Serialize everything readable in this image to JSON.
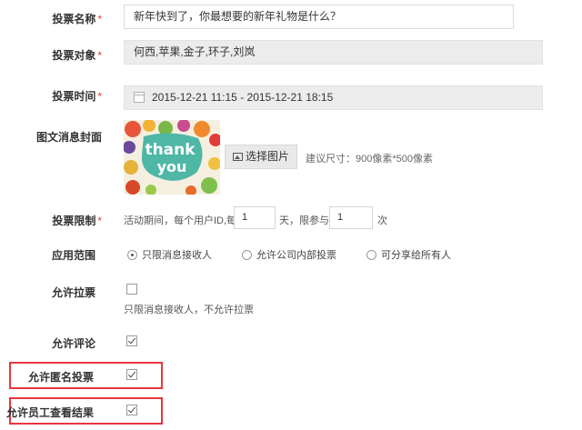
{
  "vote_name": {
    "label": "投票名称",
    "required": "*",
    "value": "新年快到了，你最想要的新年礼物是什么？"
  },
  "vote_target": {
    "label": "投票对象",
    "required": "*",
    "value": "何西,苹果,金子,环子,刘岚"
  },
  "vote_time": {
    "label": "投票时间",
    "required": "*",
    "value": "2015-12-21 11:15 - 2015-12-21 18:15"
  },
  "cover": {
    "label": "图文消息封面",
    "image_text_top": "thank",
    "image_text_bottom": "you",
    "button_label": "选择图片",
    "hint": "建议尺寸：900像素*500像素"
  },
  "vote_limit": {
    "label": "投票限制",
    "required": "*",
    "prefix": "活动期间，每个用户ID,每",
    "days_value": "1",
    "middle": "天，限参与",
    "times_value": "1",
    "suffix": "次"
  },
  "scope": {
    "label": "应用范围",
    "options": [
      "只限消息接收人",
      "允许公司内部投票",
      "可分享给所有人"
    ],
    "selected_index": 0
  },
  "canvass": {
    "label": "允许拉票",
    "checked": false,
    "note": "只限消息接收人，不允许拉票"
  },
  "comment": {
    "label": "允许评论",
    "checked": true
  },
  "anonymous": {
    "label": "允许匿名投票",
    "checked": true
  },
  "view_results": {
    "label": "允许员工查看结果",
    "checked": true
  },
  "colors": {
    "highlight_box": "#e8353b",
    "required_mark": "#e03c3c"
  }
}
